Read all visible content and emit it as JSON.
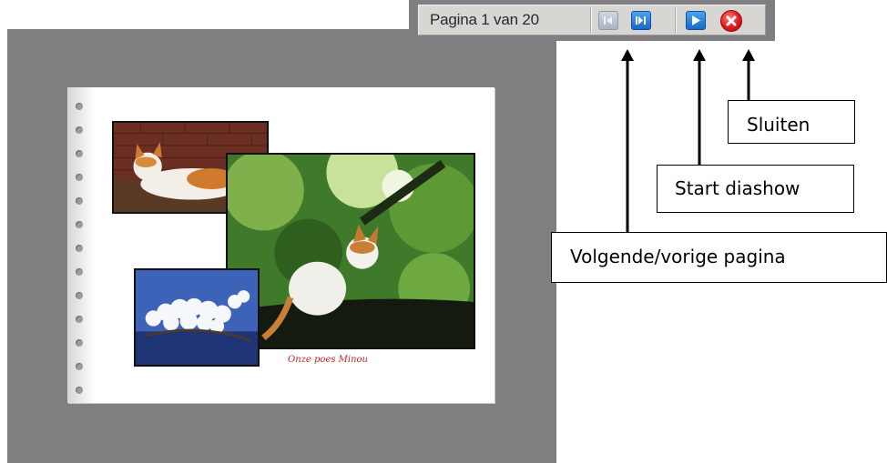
{
  "toolbar": {
    "page_indicator": "Pagina 1 van 20",
    "buttons": [
      {
        "icon": "previous-page-icon",
        "state": "disabled"
      },
      {
        "icon": "next-page-icon",
        "state": "enabled"
      },
      {
        "icon": "play-icon",
        "state": "enabled"
      },
      {
        "icon": "close-icon",
        "state": "enabled"
      }
    ]
  },
  "album": {
    "caption": "Onze poes Minou",
    "photos": [
      "cat-lying-on-wall",
      "cat-in-tree",
      "white-blossoms"
    ]
  },
  "callouts": {
    "close": "Sluiten",
    "slideshow": "Start diashow",
    "navigation": "Volgende/vorige pagina"
  },
  "colors": {
    "viewer_background": "#7f7e80",
    "toolbar_background": "#d8d6d2",
    "accent_blue": "#1869c8",
    "close_red": "#e0181b",
    "caption_red": "#c0262c"
  }
}
